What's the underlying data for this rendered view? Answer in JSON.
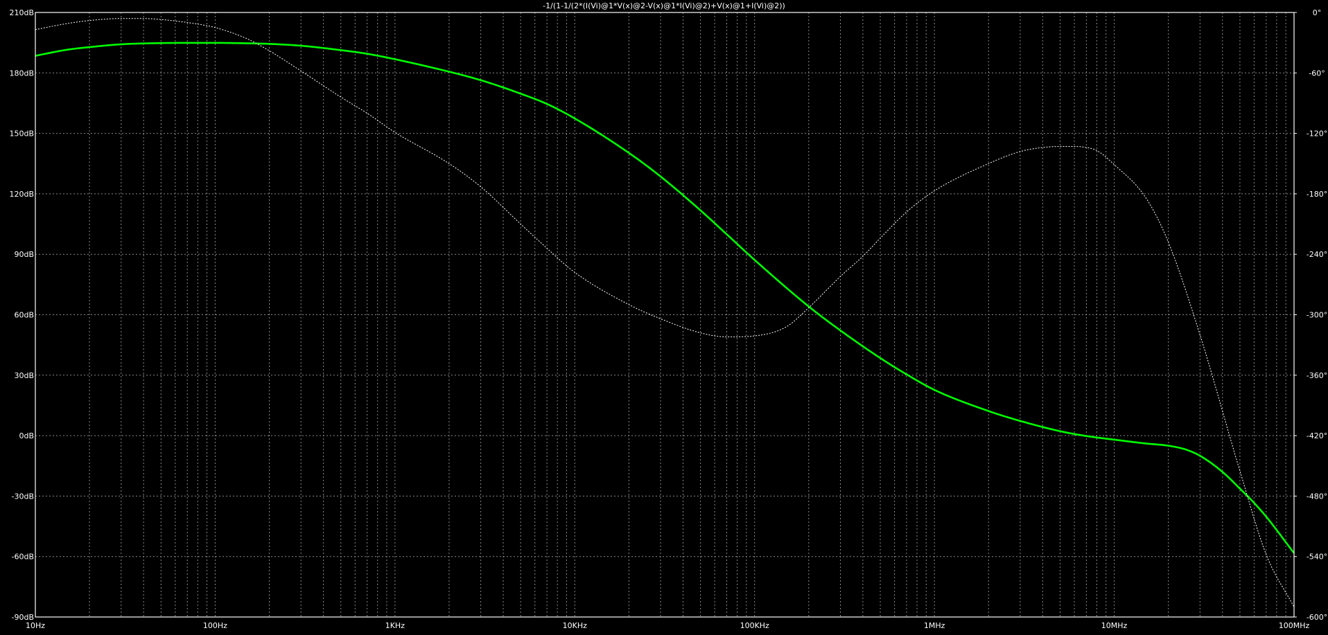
{
  "colors": {
    "background": "#000000",
    "frame": "#ffffff",
    "grid": "#8a8a8a",
    "magnitude_trace": "#00ff00",
    "phase_trace": "#ffffff"
  },
  "chart_data": {
    "type": "line",
    "title": "-1/(1-1/(2*(I(Vi)@1*V(x)@2-V(x)@1*I(Vi)@2)+V(x)@1+I(Vi)@2))",
    "x_scale": "log",
    "xlim": [
      10,
      100000000
    ],
    "x_ticks": [
      {
        "value": 10,
        "label": "10Hz"
      },
      {
        "value": 100,
        "label": "100Hz"
      },
      {
        "value": 1000,
        "label": "1KHz"
      },
      {
        "value": 10000,
        "label": "10KHz"
      },
      {
        "value": 100000,
        "label": "100KHz"
      },
      {
        "value": 1000000,
        "label": "1MHz"
      },
      {
        "value": 10000000,
        "label": "10MHz"
      },
      {
        "value": 100000000,
        "label": "100MHz"
      }
    ],
    "y_left": {
      "unit": "dB",
      "ylim": [
        -90,
        210
      ],
      "ticks": [
        {
          "value": 210,
          "label": "210dB"
        },
        {
          "value": 180,
          "label": "180dB"
        },
        {
          "value": 150,
          "label": "150dB"
        },
        {
          "value": 120,
          "label": "120dB"
        },
        {
          "value": 90,
          "label": "90dB"
        },
        {
          "value": 60,
          "label": "60dB"
        },
        {
          "value": 30,
          "label": "30dB"
        },
        {
          "value": 0,
          "label": "0dB"
        },
        {
          "value": -30,
          "label": "-30dB"
        },
        {
          "value": -60,
          "label": "-60dB"
        },
        {
          "value": -90,
          "label": "-90dB"
        }
      ]
    },
    "y_right": {
      "unit": "degrees",
      "ylim": [
        -600,
        0
      ],
      "ticks": [
        {
          "value": 0,
          "label": "0°"
        },
        {
          "value": -60,
          "label": "-60°"
        },
        {
          "value": -120,
          "label": "-120°"
        },
        {
          "value": -180,
          "label": "-180°"
        },
        {
          "value": -240,
          "label": "-240°"
        },
        {
          "value": -300,
          "label": "-300°"
        },
        {
          "value": -360,
          "label": "-360°"
        },
        {
          "value": -420,
          "label": "-420°"
        },
        {
          "value": -480,
          "label": "-480°"
        },
        {
          "value": -540,
          "label": "-540°"
        },
        {
          "value": -600,
          "label": "-600°"
        }
      ]
    },
    "grid": true,
    "series": [
      {
        "axis": "left",
        "style": "solid",
        "color": "#00ff00",
        "x": [
          10,
          15,
          20,
          30,
          50,
          70,
          100,
          150,
          200,
          300,
          500,
          700,
          1000,
          2000,
          3000,
          5000,
          7000,
          10000,
          20000,
          30000,
          50000,
          70000,
          100000,
          200000,
          300000,
          500000,
          700000,
          1000000,
          2000000,
          3000000,
          5000000,
          7000000,
          10000000,
          15000000,
          20000000,
          25000000,
          30000000,
          40000000,
          50000000,
          60000000,
          70000000,
          80000000,
          90000000,
          100000000
        ],
        "values": [
          188.5,
          191.5,
          192.8,
          194.2,
          194.8,
          194.9,
          194.9,
          194.7,
          194.4,
          193.5,
          191.3,
          189.5,
          186.8,
          180.6,
          176.4,
          169.7,
          164.6,
          157.4,
          140.3,
          128.6,
          111.8,
          99.9,
          87.2,
          64.1,
          52.2,
          38.5,
          30.4,
          22.7,
          12.2,
          7.3,
          2.2,
          -0.2,
          -2.0,
          -3.9,
          -5.0,
          -6.9,
          -10.0,
          -18.0,
          -26.3,
          -33.4,
          -40.2,
          -46.8,
          -52.9,
          -58.3
        ]
      },
      {
        "axis": "right",
        "style": "dotted",
        "color": "#ffffff",
        "x": [
          10,
          15,
          20,
          30,
          40,
          50,
          70,
          100,
          150,
          200,
          300,
          500,
          700,
          1000,
          2000,
          3000,
          5000,
          7000,
          10000,
          20000,
          30000,
          50000,
          70000,
          100000,
          150000,
          200000,
          250000,
          300000,
          400000,
          500000,
          700000,
          1000000,
          2000000,
          3000000,
          4000000,
          5000000,
          6000000,
          7000000,
          8000000,
          10000000,
          15000000,
          20000000,
          30000000,
          50000000,
          70000000,
          100000000
        ],
        "values": [
          -17,
          -11,
          -8,
          -6,
          -6,
          -7,
          -10,
          -15,
          -26,
          -38,
          -58,
          -84,
          -100,
          -119,
          -150,
          -173,
          -210,
          -234,
          -258,
          -290,
          -304,
          -318,
          -322,
          -321,
          -312,
          -293,
          -276,
          -262,
          -242,
          -224,
          -198,
          -177,
          -150,
          -138,
          -134,
          -133,
          -133,
          -134,
          -137,
          -151,
          -184,
          -228,
          -320,
          -455,
          -538,
          -590
        ]
      }
    ]
  }
}
